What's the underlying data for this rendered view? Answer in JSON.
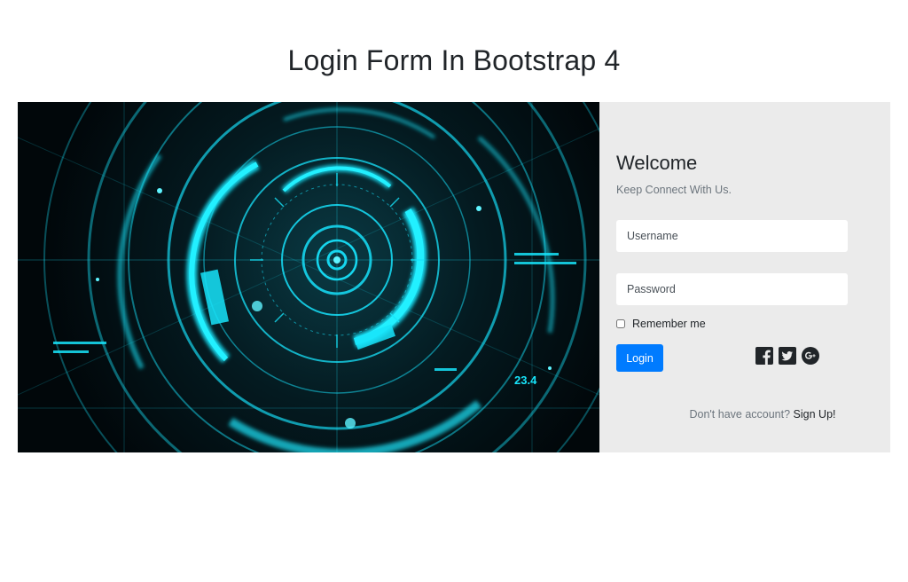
{
  "page": {
    "title": "Login Form In Bootstrap 4"
  },
  "form": {
    "heading": "Welcome",
    "subheading": "Keep Connect With Us.",
    "username_placeholder": "Username",
    "password_placeholder": "Password",
    "remember_label": "Remember me",
    "login_label": "Login",
    "signup_prompt": "Don't have account?",
    "signup_link": "Sign Up!"
  },
  "social": [
    {
      "name": "facebook-icon"
    },
    {
      "name": "twitter-icon"
    },
    {
      "name": "google-plus-icon"
    }
  ],
  "hero": {
    "label": "23.4"
  },
  "colors": {
    "primary": "#007bff",
    "panel_bg": "#ebebeb",
    "hero_cyan": "#14e0f5",
    "hero_bg": "#020609"
  }
}
